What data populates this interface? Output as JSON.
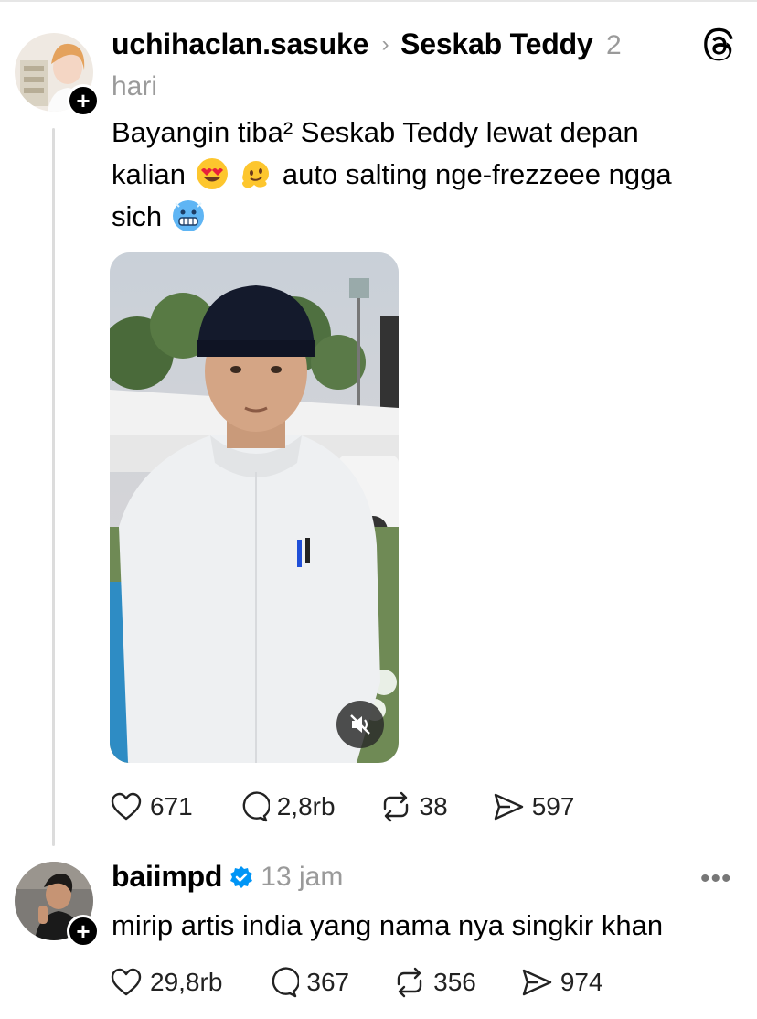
{
  "post": {
    "username": "uchihaclan.sasuke",
    "target": "Seskab Teddy",
    "time_part1": "2",
    "time_part2": "hari",
    "text_line1": "Bayangin tiba² Seskab Teddy lewat depan",
    "text_line2_a": "kalian",
    "text_line2_b": "auto salting nge-frezzeee ngga",
    "text_line3": "sich",
    "emojis": [
      "heart-eyes-emoji",
      "melting-face-emoji",
      "cold-face-emoji"
    ],
    "stats": {
      "likes": "671",
      "replies": "2,8rb",
      "reposts": "38",
      "shares": "597"
    }
  },
  "reply": {
    "username": "baiimpd",
    "time": "13 jam",
    "text": "mirip artis india yang nama nya singkir khan",
    "stats": {
      "likes": "29,8rb",
      "replies": "367",
      "reposts": "356",
      "shares": "974"
    }
  },
  "icons": {
    "follow": "+",
    "chevron": "›",
    "more": "•••"
  },
  "colors": {
    "verified": "#0095f6",
    "grey_text": "#9a9a9a"
  }
}
